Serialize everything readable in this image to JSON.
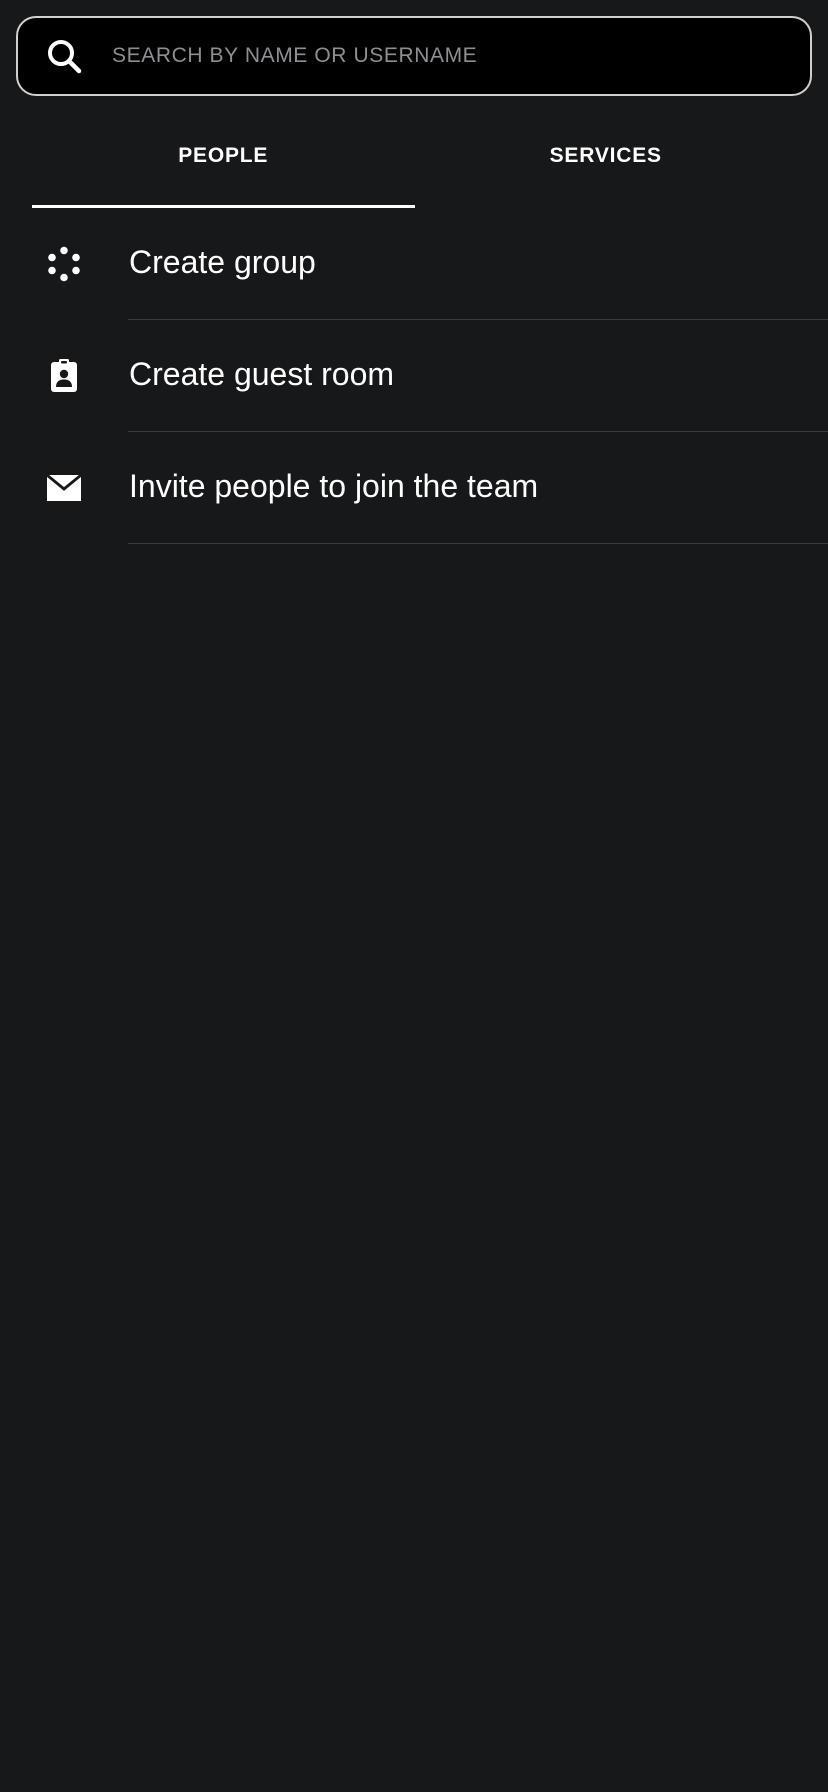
{
  "search": {
    "placeholder": "SEARCH BY NAME OR USERNAME",
    "icon": "search-icon"
  },
  "tabs": [
    {
      "label": "PEOPLE",
      "selected": true
    },
    {
      "label": "SERVICES",
      "selected": false
    }
  ],
  "actions": [
    {
      "label": "Create group",
      "icon": "group-icon"
    },
    {
      "label": "Create guest room",
      "icon": "guest-badge-icon"
    },
    {
      "label": "Invite people to join the team",
      "icon": "envelope-icon"
    }
  ],
  "colors": {
    "background": "#17181a",
    "search_background": "#000000",
    "text": "#ffffff",
    "placeholder": "#8e8e93",
    "divider": "#3a3b3e"
  }
}
